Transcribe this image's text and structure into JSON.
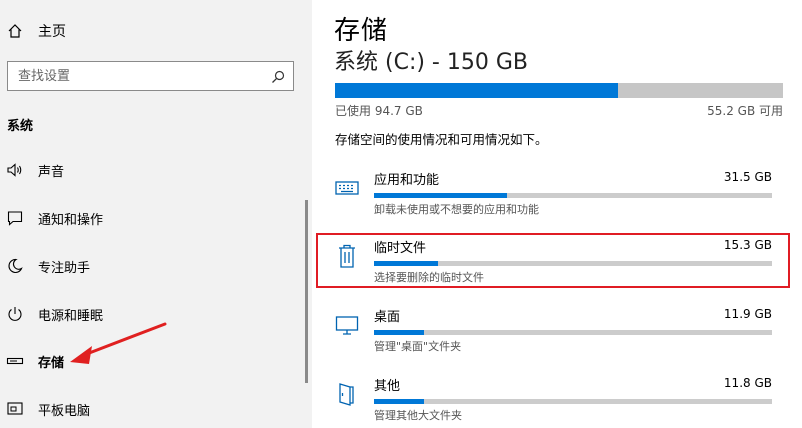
{
  "sidebar": {
    "home_label": "主页",
    "search_placeholder": "查找设置",
    "section_title": "系统",
    "items": [
      {
        "label": "声音",
        "icon": "speaker-icon"
      },
      {
        "label": "通知和操作",
        "icon": "notification-icon"
      },
      {
        "label": "专注助手",
        "icon": "moon-icon"
      },
      {
        "label": "电源和睡眠",
        "icon": "power-icon"
      },
      {
        "label": "存储",
        "icon": "storage-drive-icon",
        "active": true
      },
      {
        "label": "平板电脑",
        "icon": "tablet-icon"
      }
    ]
  },
  "main": {
    "title": "存储",
    "drive_title": "系统 (C:) - 150 GB",
    "used_label": "已使用 94.7 GB",
    "free_label": "55.2 GB 可用",
    "used_fraction": 0.631,
    "description": "存储空间的使用情况和可用情况如下。",
    "categories": [
      {
        "name": "应用和功能",
        "size": "31.5 GB",
        "sub": "卸载未使用或不想要的应用和功能",
        "icon": "keyboard-icon",
        "fraction": 0.333
      },
      {
        "name": "临时文件",
        "size": "15.3 GB",
        "sub": "选择要删除的临时文件",
        "icon": "trash-icon",
        "fraction": 0.162
      },
      {
        "name": "桌面",
        "size": "11.9 GB",
        "sub": "管理\"桌面\"文件夹",
        "icon": "monitor-icon",
        "fraction": 0.126
      },
      {
        "name": "其他",
        "size": "11.8 GB",
        "sub": "管理其他大文件夹",
        "icon": "other-files-icon",
        "fraction": 0.125
      }
    ]
  },
  "colors": {
    "accent": "#0078d7",
    "highlight": "#e01c24",
    "annotation_arrow": "#e02020"
  }
}
